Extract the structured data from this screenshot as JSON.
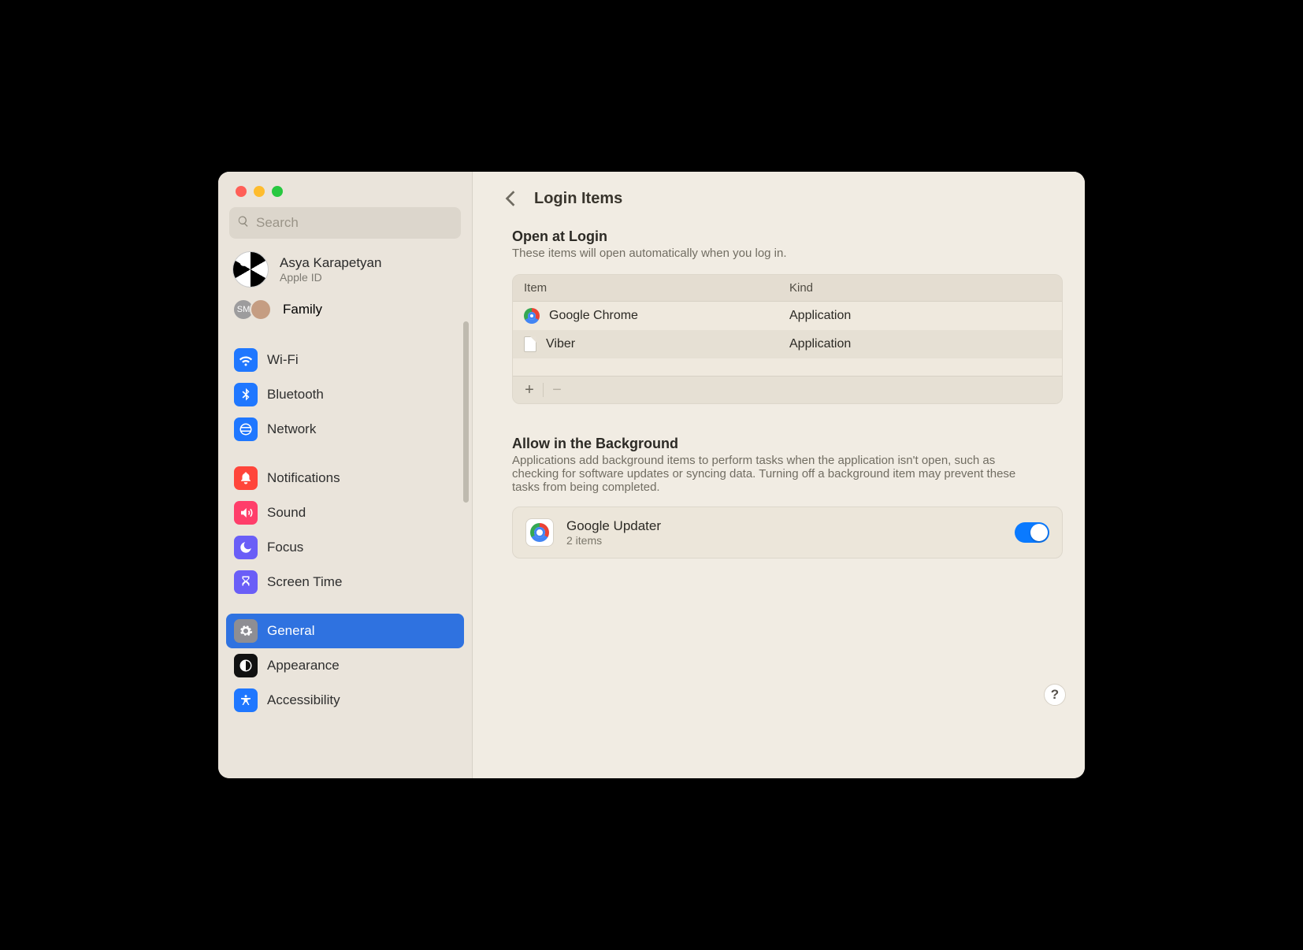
{
  "search": {
    "placeholder": "Search"
  },
  "account": {
    "name": "Asya Karapetyan",
    "sub": "Apple ID"
  },
  "family": {
    "label": "Family"
  },
  "sidebar": {
    "items": [
      {
        "label": "Wi-Fi"
      },
      {
        "label": "Bluetooth"
      },
      {
        "label": "Network"
      },
      {
        "label": "Notifications"
      },
      {
        "label": "Sound"
      },
      {
        "label": "Focus"
      },
      {
        "label": "Screen Time"
      },
      {
        "label": "General"
      },
      {
        "label": "Appearance"
      },
      {
        "label": "Accessibility"
      }
    ]
  },
  "page": {
    "title": "Login Items"
  },
  "open_at_login": {
    "heading": "Open at Login",
    "sub": "These items will open automatically when you log in.",
    "columns": {
      "item": "Item",
      "kind": "Kind"
    },
    "rows": [
      {
        "name": "Google Chrome",
        "kind": "Application",
        "icon": "chrome"
      },
      {
        "name": "Viber",
        "kind": "Application",
        "icon": "doc"
      }
    ]
  },
  "background": {
    "heading": "Allow in the Background",
    "sub": "Applications add background items to perform tasks when the application isn't open, such as checking for software updates or syncing data. Turning off a background item may prevent these tasks from being completed.",
    "items": [
      {
        "name": "Google Updater",
        "count": "2 items",
        "enabled": true
      }
    ]
  },
  "help": {
    "glyph": "?"
  },
  "buttons": {
    "plus": "+",
    "minus": "−"
  }
}
